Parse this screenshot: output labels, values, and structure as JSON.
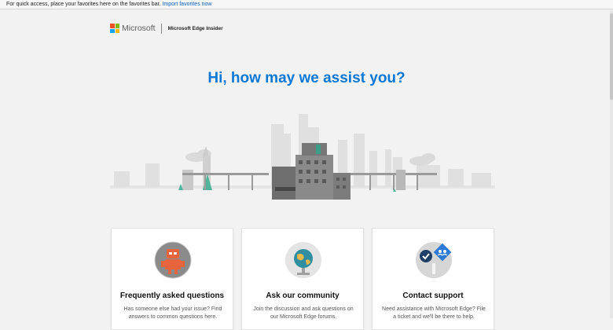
{
  "favorites_bar": {
    "text": "For quick access, place your favorites here on the favorites bar.",
    "import_link": "Import favorites now"
  },
  "brand": {
    "microsoft": "Microsoft",
    "product": "Microsoft Edge Insider",
    "logo_colors": [
      "#f25022",
      "#7fba00",
      "#00a4ef",
      "#ffb900"
    ]
  },
  "hero": {
    "title": "Hi, how may we assist you?",
    "title_color": "#0a78d4"
  },
  "cards": [
    {
      "icon": "robot-icon",
      "title": "Frequently asked questions",
      "desc": "Has someone else had your issue? Find answers to common questions here."
    },
    {
      "icon": "globe-icon",
      "title": "Ask our community",
      "desc": "Join the discussion and ask questions on our Microsoft Edge forums."
    },
    {
      "icon": "support-people-icon",
      "title": "Contact support",
      "desc": "Need assistance with Microsoft Edge? File a ticket and we'll be there to help."
    }
  ]
}
